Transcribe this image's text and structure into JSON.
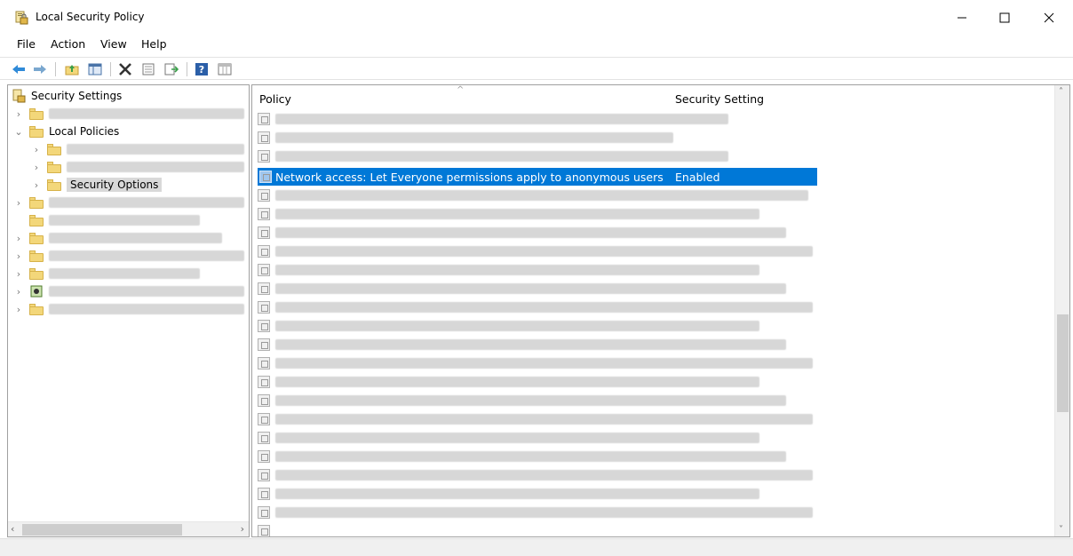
{
  "window": {
    "title": "Local Security Policy",
    "app_icon": "local-security-policy-icon"
  },
  "menu": [
    "File",
    "Action",
    "View",
    "Help"
  ],
  "toolbar": {
    "icons": [
      "back-arrow-icon",
      "forward-arrow-icon",
      "up-folder-icon",
      "show-hide-console-tree-icon",
      "delete-icon",
      "properties-icon",
      "export-list-icon",
      "help-icon",
      "view-icon"
    ]
  },
  "tree": {
    "root": "Security Settings",
    "local_policies": "Local Policies",
    "security_options": "Security Options"
  },
  "list": {
    "col_policy": "Policy",
    "col_setting": "Security Setting",
    "selected_policy": "Network access: Let Everyone permissions apply to anonymous users",
    "selected_setting": "Enabled"
  },
  "colors": {
    "selection": "#0078d7",
    "folder": "#f3d77a"
  }
}
